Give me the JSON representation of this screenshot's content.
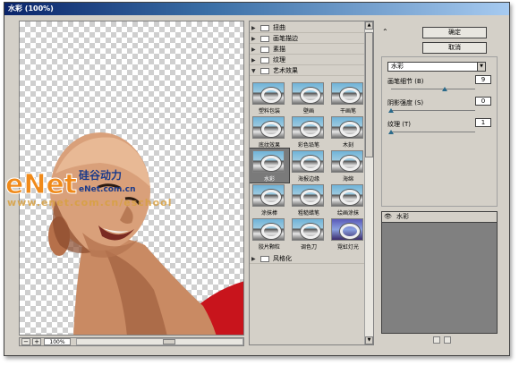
{
  "window": {
    "title": "水彩 (100%)"
  },
  "preview": {
    "zoom": "100%"
  },
  "gallery": {
    "categories": [
      {
        "label": "扭曲",
        "expanded": false
      },
      {
        "label": "画笔描边",
        "expanded": false
      },
      {
        "label": "素描",
        "expanded": false
      },
      {
        "label": "纹理",
        "expanded": false
      },
      {
        "label": "艺术效果",
        "expanded": true
      },
      {
        "label": "风格化",
        "expanded": false
      }
    ],
    "filters": [
      {
        "label": "塑料包装"
      },
      {
        "label": "壁画"
      },
      {
        "label": "干画笔"
      },
      {
        "label": "底纹效果"
      },
      {
        "label": "彩色铅笔"
      },
      {
        "label": "木刻"
      },
      {
        "label": "水彩",
        "selected": true
      },
      {
        "label": "海报边缘"
      },
      {
        "label": "海绵"
      },
      {
        "label": "涂抹棒"
      },
      {
        "label": "粗糙蜡笔"
      },
      {
        "label": "绘画涂抹"
      },
      {
        "label": "胶片颗粒"
      },
      {
        "label": "调色刀"
      },
      {
        "label": "霓虹灯光"
      }
    ]
  },
  "buttons": {
    "ok": "确定",
    "cancel": "取消",
    "collapse": "⌃"
  },
  "settings": {
    "filter_select": "水彩",
    "params": [
      {
        "label": "画笔细节 (B)",
        "value": "9",
        "level": 0.64
      },
      {
        "label": "阴影强度 (S)",
        "value": "0",
        "level": 0.0
      },
      {
        "label": "纹理 (T)",
        "value": "1",
        "level": 0.0
      }
    ]
  },
  "layers": {
    "row_label": "水彩",
    "eye": "👁"
  },
  "watermark": {
    "logo_text": "eNet",
    "cn_text": "硅谷动力",
    "site": "eNet.com.cn",
    "url": "www.enet.com.cn/eschool"
  },
  "colors": {
    "title_start": "#0a246a",
    "title_end": "#a6caf0",
    "panel": "#d4d0c8",
    "selection": "#7a7a7a",
    "watermark_orange": "#f08a1a"
  }
}
